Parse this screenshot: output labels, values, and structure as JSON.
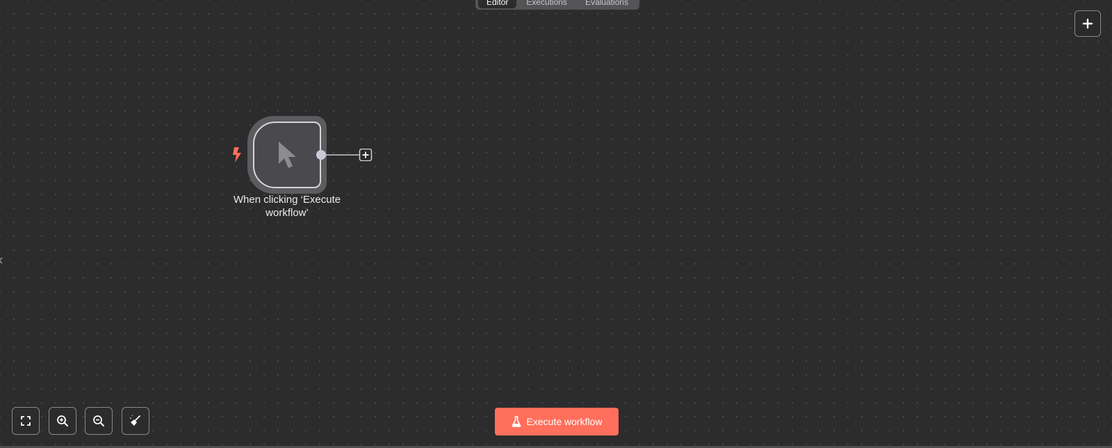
{
  "tabs": [
    {
      "label": "Editor",
      "active": true
    },
    {
      "label": "Executions",
      "active": false
    },
    {
      "label": "Evaluations",
      "active": false
    }
  ],
  "node": {
    "label_line1": "When clicking ‘Execute",
    "label_line2": "workflow’",
    "icon": "cursor-pointer-icon",
    "trigger_icon": "lightning-bolt-icon"
  },
  "canvas_controls": [
    {
      "name": "fit-view",
      "icon": "fullscreen-icon"
    },
    {
      "name": "zoom-in",
      "icon": "zoom-in-icon"
    },
    {
      "name": "zoom-out",
      "icon": "zoom-out-icon"
    },
    {
      "name": "tidy-up",
      "icon": "broom-icon"
    }
  ],
  "execute_button": {
    "label": "Execute workflow",
    "icon": "flask-icon"
  },
  "colors": {
    "accent": "#ff6f5c",
    "canvas_bg": "#2c2c2d"
  }
}
